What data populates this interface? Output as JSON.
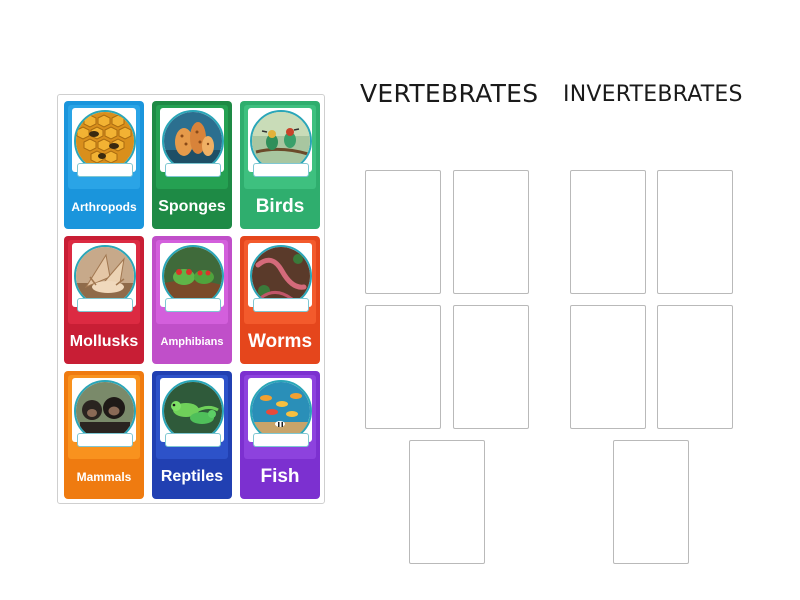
{
  "groups": {
    "vertebrates_title": "VERTEBRATES",
    "invertebrates_title": "INVERTEBRATES"
  },
  "cards": [
    {
      "id": "arthropods",
      "label": "Arthropods",
      "color": "#1a95dc",
      "inner_color": "#2aa4e6",
      "icon": "bee-honeycomb-icon"
    },
    {
      "id": "sponges",
      "label": "Sponges",
      "color": "#1e8a45",
      "inner_color": "#25a152",
      "icon": "sponge-coral-icon"
    },
    {
      "id": "birds",
      "label": "Birds",
      "color": "#2fae6e",
      "inner_color": "#3ec07f",
      "icon": "bird-icon"
    },
    {
      "id": "mollusks",
      "label": "Mollusks",
      "color": "#c81e35",
      "inner_color": "#dc2a42",
      "icon": "snail-shell-icon"
    },
    {
      "id": "amphibians",
      "label": "Amphibians",
      "color": "#c04fc9",
      "inner_color": "#d35fdc",
      "icon": "frog-icon"
    },
    {
      "id": "worms",
      "label": "Worms",
      "color": "#e5461c",
      "inner_color": "#f35a2c",
      "icon": "worm-icon"
    },
    {
      "id": "mammals",
      "label": "Mammals",
      "color": "#ef7b10",
      "inner_color": "#f9921e",
      "icon": "chimpanzee-icon"
    },
    {
      "id": "reptiles",
      "label": "Reptiles",
      "color": "#2140b2",
      "inner_color": "#2d52c9",
      "icon": "lizard-icon"
    },
    {
      "id": "fish",
      "label": "Fish",
      "color": "#7c30d0",
      "inner_color": "#8d42de",
      "icon": "fish-school-icon"
    }
  ]
}
